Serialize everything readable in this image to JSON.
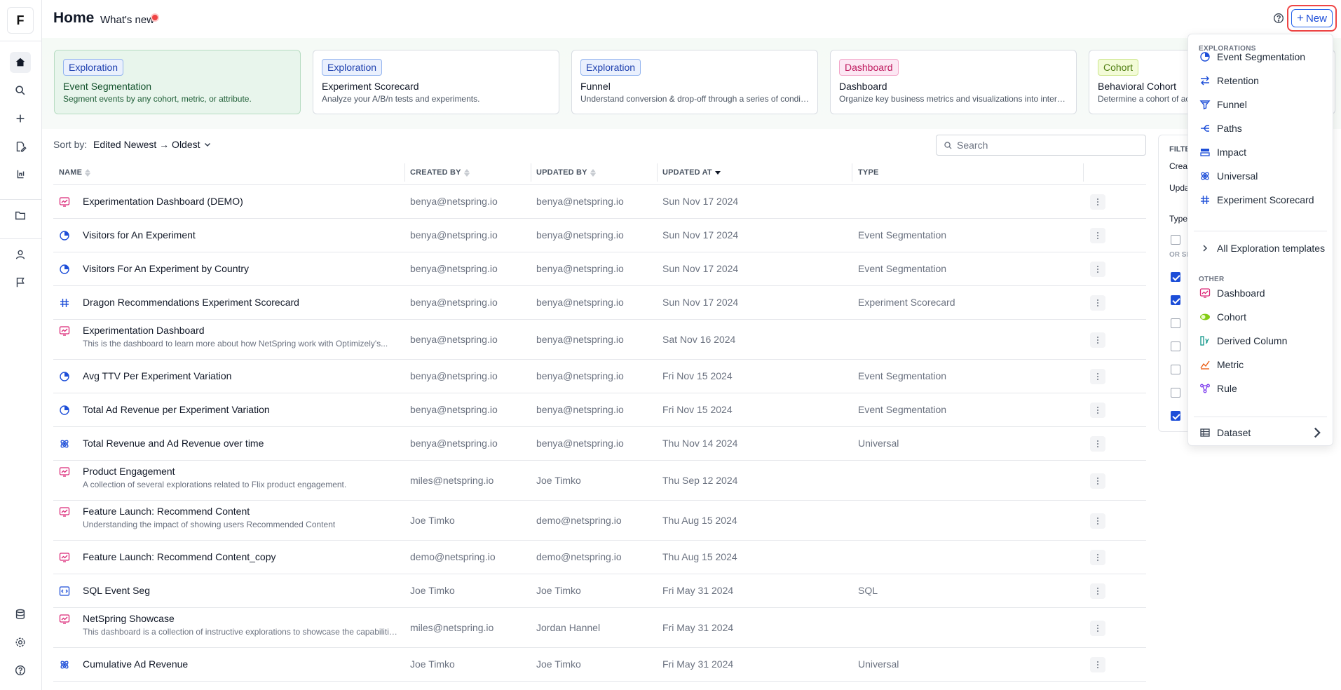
{
  "app": {
    "logo": "F"
  },
  "header": {
    "title": "Home",
    "whats_new": "What's new",
    "new_button": "New"
  },
  "templates": [
    {
      "chip": "Exploration",
      "chip_kind": "exploration",
      "title": "Event Segmentation",
      "desc": "Segment events by any cohort, metric, or attribute.",
      "selected": true
    },
    {
      "chip": "Exploration",
      "chip_kind": "exploration",
      "title": "Experiment Scorecard",
      "desc": "Analyze your A/B/n tests and experiments."
    },
    {
      "chip": "Exploration",
      "chip_kind": "exploration",
      "title": "Funnel",
      "desc": "Understand conversion & drop-off through a series of conditi..."
    },
    {
      "chip": "Dashboard",
      "chip_kind": "dashboard",
      "title": "Dashboard",
      "desc": "Organize key business metrics and visualizations into interacti..."
    },
    {
      "chip": "Cohort",
      "chip_kind": "cohort",
      "title": "Behavioral Cohort",
      "desc": "Determine a cohort of act"
    }
  ],
  "sort": {
    "label": "Sort by:",
    "value": "Edited Newest → Oldest"
  },
  "search": {
    "placeholder": "Search"
  },
  "table": {
    "headers": {
      "name": "NAME",
      "created_by": "CREATED BY",
      "updated_by": "UPDATED BY",
      "updated_at": "UPDATED AT",
      "type": "TYPE"
    },
    "rows": [
      {
        "icon": "dashboard",
        "name": "Experimentation Dashboard (DEMO)",
        "desc": "",
        "created_by": "benya@netspring.io",
        "updated_by": "benya@netspring.io",
        "updated_at": "Sun Nov 17 2024",
        "type": ""
      },
      {
        "icon": "segmentation",
        "name": "Visitors for An Experiment",
        "desc": "",
        "created_by": "benya@netspring.io",
        "updated_by": "benya@netspring.io",
        "updated_at": "Sun Nov 17 2024",
        "type": "Event Segmentation"
      },
      {
        "icon": "segmentation",
        "name": "Visitors For An Experiment by Country",
        "desc": "",
        "created_by": "benya@netspring.io",
        "updated_by": "benya@netspring.io",
        "updated_at": "Sun Nov 17 2024",
        "type": "Event Segmentation"
      },
      {
        "icon": "scorecard",
        "name": "Dragon Recommendations Experiment Scorecard",
        "desc": "",
        "created_by": "benya@netspring.io",
        "updated_by": "benya@netspring.io",
        "updated_at": "Sun Nov 17 2024",
        "type": "Experiment Scorecard"
      },
      {
        "icon": "dashboard",
        "name": "Experimentation Dashboard",
        "desc": "This is the dashboard to learn more about how NetSpring work with Optimizely's...",
        "created_by": "benya@netspring.io",
        "updated_by": "benya@netspring.io",
        "updated_at": "Sat Nov 16 2024",
        "type": ""
      },
      {
        "icon": "segmentation",
        "name": "Avg TTV Per Experiment Variation",
        "desc": "",
        "created_by": "benya@netspring.io",
        "updated_by": "benya@netspring.io",
        "updated_at": "Fri Nov 15 2024",
        "type": "Event Segmentation"
      },
      {
        "icon": "segmentation",
        "name": "Total Ad Revenue per Experiment Variation",
        "desc": "",
        "created_by": "benya@netspring.io",
        "updated_by": "benya@netspring.io",
        "updated_at": "Fri Nov 15 2024",
        "type": "Event Segmentation"
      },
      {
        "icon": "universal",
        "name": "Total Revenue and Ad Revenue over time",
        "desc": "",
        "created_by": "benya@netspring.io",
        "updated_by": "benya@netspring.io",
        "updated_at": "Thu Nov 14 2024",
        "type": "Universal"
      },
      {
        "icon": "dashboard",
        "name": "Product Engagement",
        "desc": "A collection of several explorations related to Flix product engagement.",
        "created_by": "miles@netspring.io",
        "updated_by": "Joe Timko",
        "updated_at": "Thu Sep 12 2024",
        "type": ""
      },
      {
        "icon": "dashboard",
        "name": "Feature Launch: Recommend Content",
        "desc": "Understanding the impact of showing users Recommended Content",
        "created_by": "Joe Timko",
        "updated_by": "demo@netspring.io",
        "updated_at": "Thu Aug 15 2024",
        "type": ""
      },
      {
        "icon": "dashboard",
        "name": "Feature Launch: Recommend Content_copy",
        "desc": "",
        "created_by": "demo@netspring.io",
        "updated_by": "demo@netspring.io",
        "updated_at": "Thu Aug 15 2024",
        "type": ""
      },
      {
        "icon": "sql",
        "name": "SQL Event Seg",
        "desc": "",
        "created_by": "Joe Timko",
        "updated_by": "Joe Timko",
        "updated_at": "Fri May 31 2024",
        "type": "SQL"
      },
      {
        "icon": "dashboard",
        "name": "NetSpring Showcase",
        "desc": "This dashboard is a collection of instructive explorations to showcase the capabilities ...",
        "created_by": "miles@netspring.io",
        "updated_by": "Jordan Hannel",
        "updated_at": "Fri May 31 2024",
        "type": ""
      },
      {
        "icon": "universal",
        "name": "Cumulative Ad Revenue",
        "desc": "",
        "created_by": "Joe Timko",
        "updated_by": "Joe Timko",
        "updated_at": "Fri May 31 2024",
        "type": "Universal"
      }
    ]
  },
  "filter_panel": {
    "title": "FILTE",
    "created": "Crea",
    "updated": "Upda",
    "type": "Type",
    "or_show": "OR SH",
    "checkboxes": [
      false,
      true,
      true,
      false,
      false,
      false,
      false,
      true
    ]
  },
  "new_menu": {
    "explorations_label": "EXPLORATIONS",
    "explorations": [
      {
        "label": "Event Segmentation",
        "icon": "segmentation-icon"
      },
      {
        "label": "Retention",
        "icon": "retention-icon"
      },
      {
        "label": "Funnel",
        "icon": "funnel-icon"
      },
      {
        "label": "Paths",
        "icon": "paths-icon"
      },
      {
        "label": "Impact",
        "icon": "impact-icon"
      },
      {
        "label": "Universal",
        "icon": "universal-icon"
      },
      {
        "label": "Experiment Scorecard",
        "icon": "scorecard-icon"
      }
    ],
    "all_templates": "All Exploration templates",
    "other_label": "OTHER",
    "other": [
      {
        "label": "Dashboard",
        "icon": "dashboard-icon"
      },
      {
        "label": "Cohort",
        "icon": "cohort-icon"
      },
      {
        "label": "Derived Column",
        "icon": "derived-column-icon"
      },
      {
        "label": "Metric",
        "icon": "metric-icon"
      },
      {
        "label": "Rule",
        "icon": "rule-icon"
      }
    ],
    "dataset": "Dataset"
  },
  "colors": {
    "accent": "#1d4ed8",
    "dashboard": "#db2777",
    "cohort": "#65a30d",
    "highlight": "#ef4444"
  }
}
